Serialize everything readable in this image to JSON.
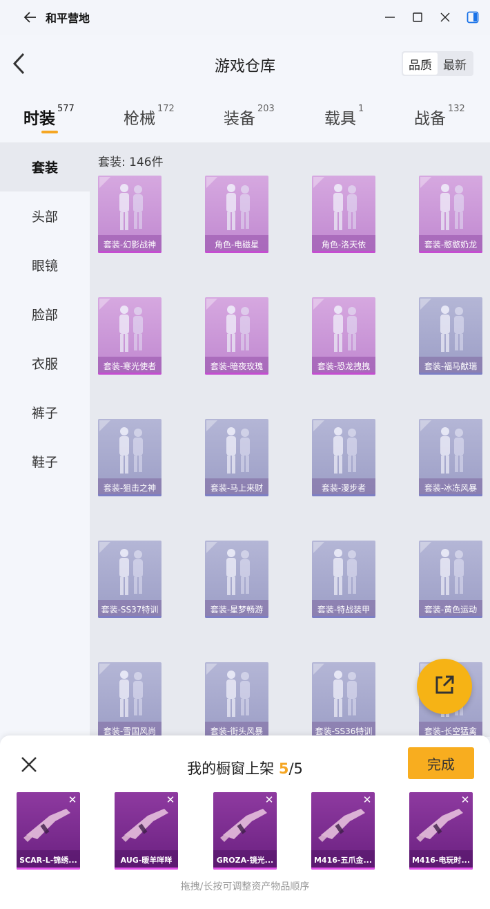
{
  "window": {
    "title": "和平营地",
    "back_icon": "arrow-left-icon",
    "controls": [
      "minimize-icon",
      "maximize-icon",
      "close-icon",
      "sidebar-toggle-icon"
    ]
  },
  "header": {
    "title": "游戏仓库",
    "back_icon": "chevron-left-icon",
    "sort": {
      "options": [
        "品质",
        "最新"
      ],
      "selected": "品质"
    }
  },
  "categories": [
    {
      "label": "时装",
      "count": "577",
      "active": true
    },
    {
      "label": "枪械",
      "count": "172",
      "active": false
    },
    {
      "label": "装备",
      "count": "203",
      "active": false
    },
    {
      "label": "载具",
      "count": "1",
      "active": false
    },
    {
      "label": "战备",
      "count": "132",
      "active": false
    }
  ],
  "sidebar": {
    "items": [
      {
        "label": "套装",
        "active": true
      },
      {
        "label": "头部"
      },
      {
        "label": "眼镜"
      },
      {
        "label": "脸部"
      },
      {
        "label": "衣服"
      },
      {
        "label": "裤子"
      },
      {
        "label": "鞋子"
      }
    ]
  },
  "grid": {
    "count_label": "套装: 146件",
    "items": [
      {
        "name": "套装-幻影战神",
        "rarity": "purple"
      },
      {
        "name": "角色-电磁星",
        "rarity": "purple"
      },
      {
        "name": "角色-洛天依",
        "rarity": "purple"
      },
      {
        "name": "套装-憨憨奶龙",
        "rarity": "purple"
      },
      {
        "name": "套装-寒光使者",
        "rarity": "purple"
      },
      {
        "name": "套装-暗夜玫瑰",
        "rarity": "purple"
      },
      {
        "name": "套装-恐龙拽拽",
        "rarity": "purple"
      },
      {
        "name": "套装-福马献瑞",
        "rarity": "blue"
      },
      {
        "name": "套装-狙击之神",
        "rarity": "blue"
      },
      {
        "name": "套装-马上来财",
        "rarity": "blue"
      },
      {
        "name": "套装-漫步者",
        "rarity": "blue"
      },
      {
        "name": "套装-冰冻风暴",
        "rarity": "blue"
      },
      {
        "name": "套装-SS37特训",
        "rarity": "blue"
      },
      {
        "name": "套装-星梦畅游",
        "rarity": "blue"
      },
      {
        "name": "套装-特战装甲",
        "rarity": "blue"
      },
      {
        "name": "套装-黄色运动",
        "rarity": "blue"
      },
      {
        "name": "套装-雪国风尚",
        "rarity": "blue"
      },
      {
        "name": "套装-街头风暴",
        "rarity": "blue"
      },
      {
        "name": "套装-SS36特训",
        "rarity": "blue"
      },
      {
        "name": "套装-长空猛禽",
        "rarity": "blue"
      }
    ]
  },
  "fab": {
    "icon": "share-icon"
  },
  "showcase": {
    "title_prefix": "我的橱窗上架 ",
    "filled": "5",
    "total_text": "/5",
    "done_label": "完成",
    "close_icon": "close-icon",
    "hint": "拖拽/长按可调整资产物品顺序",
    "slots": [
      {
        "name": "SCAR-L-锦绣..."
      },
      {
        "name": "AUG-暖羊咩咩"
      },
      {
        "name": "GROZA-镜光..."
      },
      {
        "name": "M416-五爪金..."
      },
      {
        "name": "M416-电玩时..."
      }
    ]
  },
  "colors": {
    "accent": "#f5a623",
    "done_button": "#f8ad1f",
    "purple_card": "#c088d0",
    "blue_card": "#9c9ec6",
    "showcase_card": "#7a2a90"
  }
}
